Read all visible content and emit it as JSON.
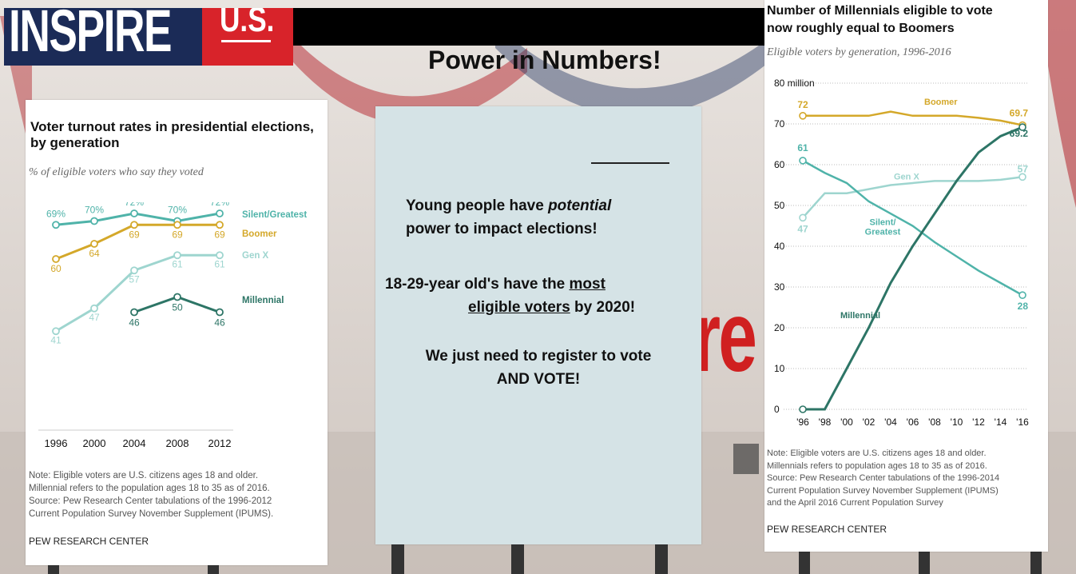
{
  "header": {
    "logo_word": "INSPIRE",
    "logo_badge": "U.S.",
    "title": "Power in Numbers!",
    "background_red_text": "re"
  },
  "message": {
    "line1_a": "Young people have ",
    "line1_em": "potential",
    "line2": "power to impact elections!",
    "line3_a": "18-29-year old's have the ",
    "line3_u": "most",
    "line4_u": "eligible voters",
    "line4_b": " by 2020!",
    "line5": "We just need to register to vote",
    "line6": "AND VOTE!"
  },
  "chart_data": [
    {
      "type": "line",
      "title": "Voter turnout rates in presidential elections, by generation",
      "subtitle": "% of eligible voters who say they voted",
      "x": [
        1996,
        2000,
        2004,
        2008,
        2012
      ],
      "series": [
        {
          "name": "Silent/Greatest",
          "color": "#4fb3a9",
          "values": [
            69,
            70,
            72,
            70,
            72
          ],
          "labels": [
            "69%",
            "70%",
            "72%",
            "70%",
            "72%"
          ]
        },
        {
          "name": "Boomer",
          "color": "#d4a82a",
          "values": [
            60,
            64,
            69,
            69,
            69
          ],
          "labels": [
            "60",
            "64",
            "69",
            "69",
            "69"
          ]
        },
        {
          "name": "Gen X",
          "color": "#9ed5cf",
          "values": [
            41,
            47,
            57,
            61,
            61
          ],
          "labels": [
            "41",
            "47",
            "57",
            "61",
            "61"
          ]
        },
        {
          "name": "Millennial",
          "color": "#2d7566",
          "values": [
            null,
            null,
            46,
            50,
            46
          ],
          "labels": [
            "",
            "",
            "46",
            "50",
            "46"
          ]
        }
      ],
      "note": [
        "Note: Eligible voters are U.S. citizens ages 18 and older.",
        "Millennial refers to the population ages 18 to 35 as of 2016.",
        "Source: Pew Research Center tabulations of the 1996-2012",
        "Current Population Survey November Supplement (IPUMS)."
      ],
      "source": "PEW RESEARCH CENTER"
    },
    {
      "type": "line",
      "title_line1": "Number of Millennials eligible to vote",
      "title_line2": "now roughly equal to Boomers",
      "subtitle": "Eligible voters by generation, 1996-2016",
      "x": [
        1996,
        1998,
        2000,
        2002,
        2004,
        2006,
        2008,
        2010,
        2012,
        2014,
        2016
      ],
      "xticks": [
        "'96",
        "'98",
        "'00",
        "'02",
        "'04",
        "'06",
        "'08",
        "'10",
        "'12",
        "'14",
        "'16"
      ],
      "yticks": [
        "0",
        "10",
        "20",
        "30",
        "40",
        "50",
        "60",
        "70",
        "80 million"
      ],
      "ylim": [
        0,
        80
      ],
      "grid": true,
      "series": [
        {
          "name": "Boomer",
          "color": "#d4a82a",
          "values": [
            72,
            72,
            72,
            72,
            73,
            72,
            72,
            72,
            71.5,
            70.8,
            69.7
          ],
          "start_label": "72",
          "end_label": "69.7"
        },
        {
          "name": "Gen X",
          "color": "#9ed5cf",
          "values": [
            47,
            53,
            53,
            54,
            55,
            55.5,
            56,
            56,
            56,
            56.3,
            57
          ],
          "start_label": "47",
          "end_label": "57"
        },
        {
          "name": "Silent/Greatest",
          "color": "#4fb3a9",
          "values": [
            61,
            58,
            55.5,
            51,
            48,
            45,
            41,
            37.5,
            34,
            31,
            28
          ],
          "start_label": "61",
          "end_label": "28"
        },
        {
          "name": "Millennial",
          "color": "#2d7566",
          "values": [
            0,
            0,
            10,
            20,
            31,
            40,
            48,
            56,
            63,
            67,
            69.2
          ],
          "start_label": "",
          "end_label": "69.2"
        }
      ],
      "note": [
        "Note: Eligible voters are U.S. citizens ages 18 and older.",
        "Millennials refers to population ages 18 to 35 as of 2016.",
        "Source: Pew Research Center tabulations of the 1996-2014",
        "Current Population Survey November Supplement (IPUMS)",
        "and the April 2016 Current Population Survey"
      ],
      "source": "PEW RESEARCH CENTER"
    }
  ]
}
